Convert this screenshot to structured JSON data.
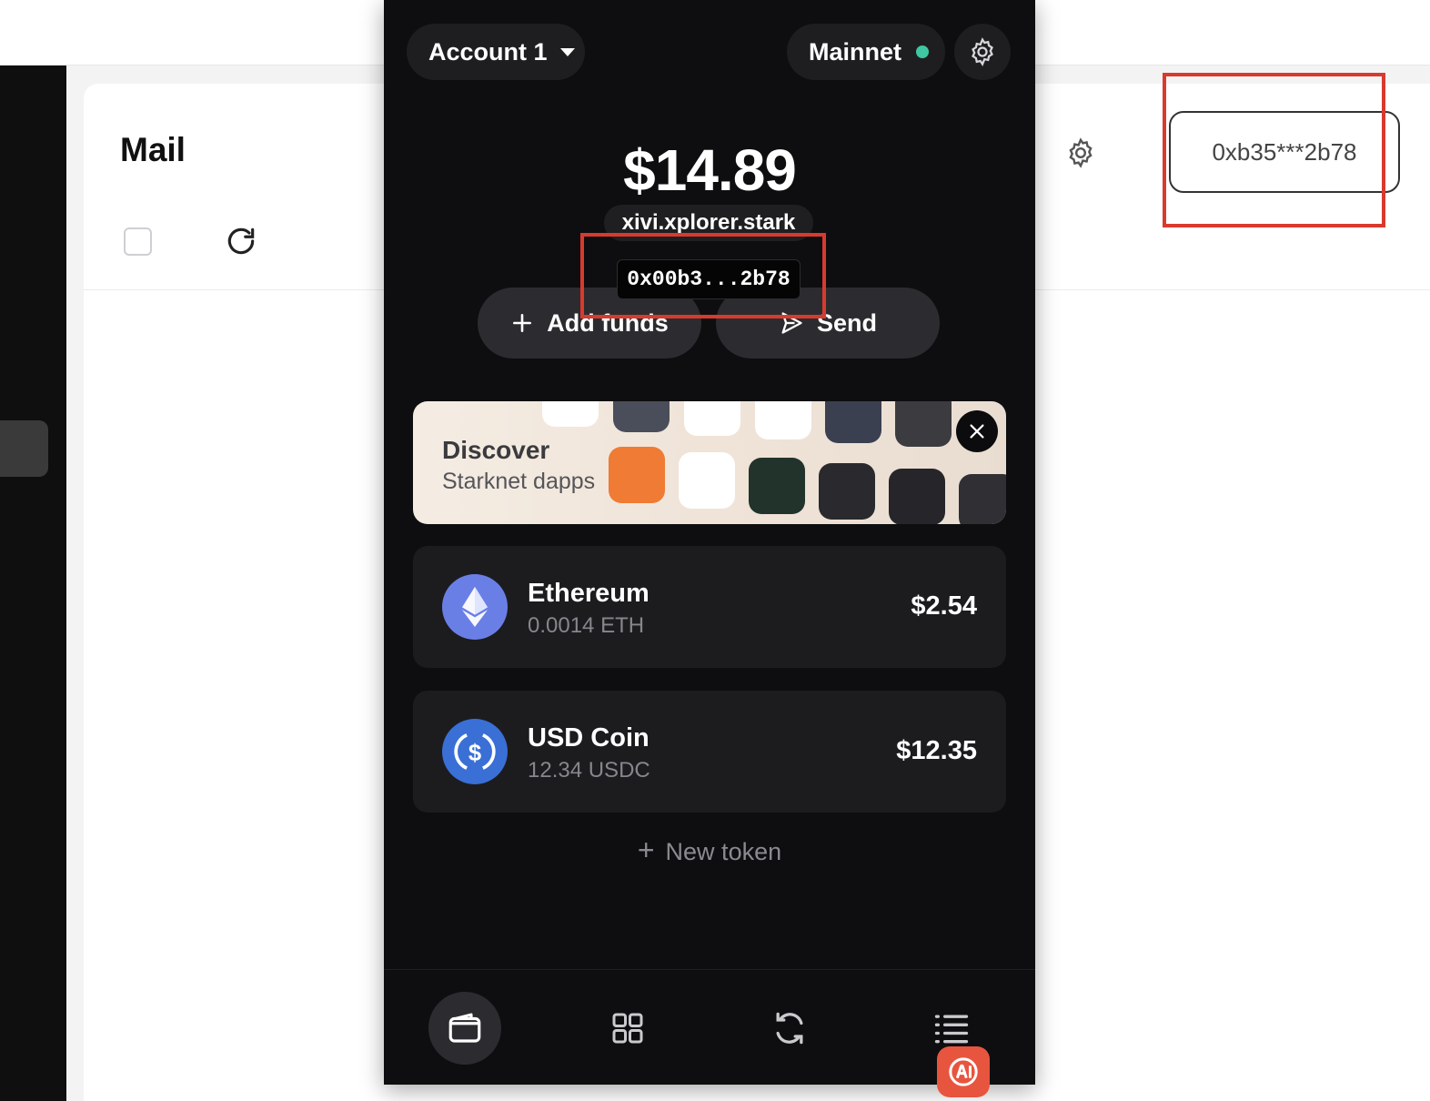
{
  "mail": {
    "title": "Mail",
    "address_pill": "0xb35***2b78"
  },
  "wallet": {
    "account_label": "Account 1",
    "network_label": "Mainnet",
    "balance": "$14.89",
    "stark_name": "xivi.xplorer.stark",
    "address_tooltip": "0x00b3...2b78",
    "add_funds_label": "Add funds",
    "send_label": "Send",
    "discover": {
      "title": "Discover",
      "subtitle": "Starknet dapps"
    },
    "tokens": [
      {
        "name": "Ethereum",
        "amount": "0.0014 ETH",
        "value": "$2.54",
        "icon": "ethereum-icon",
        "color": "#6a7fe6"
      },
      {
        "name": "USD Coin",
        "amount": "12.34 USDC",
        "value": "$12.35",
        "icon": "usdc-icon",
        "color": "#3a6fd6"
      }
    ],
    "new_token_label": "New token"
  },
  "colors": {
    "highlight": "#d93a2e",
    "network_dot": "#3ec7a0",
    "wallet_bg": "#0e0e10",
    "ai_badge": "#e8553f"
  }
}
